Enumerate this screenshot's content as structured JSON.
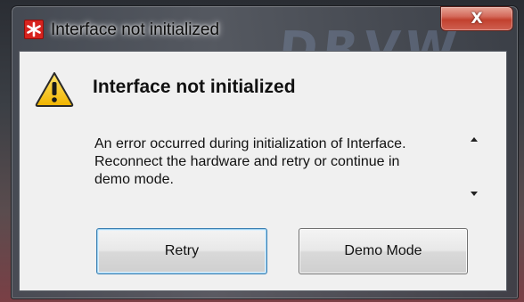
{
  "window": {
    "title": "Interface not initialized",
    "background_text": "DRVW",
    "close_symbol": "X",
    "app_icon": "asterisk-icon"
  },
  "dialog": {
    "icon": "warning-icon",
    "heading": "Interface not initialized",
    "message": "An error occurred during initialization of Interface. Reconnect the hardware and retry or continue in demo mode.",
    "buttons": {
      "retry": "Retry",
      "demo": "Demo Mode"
    }
  },
  "colors": {
    "close_button": "#c2412e",
    "app_icon": "#d7231e",
    "warning_fill": "#f6c21a",
    "default_button_border": "#3c7fb1"
  }
}
